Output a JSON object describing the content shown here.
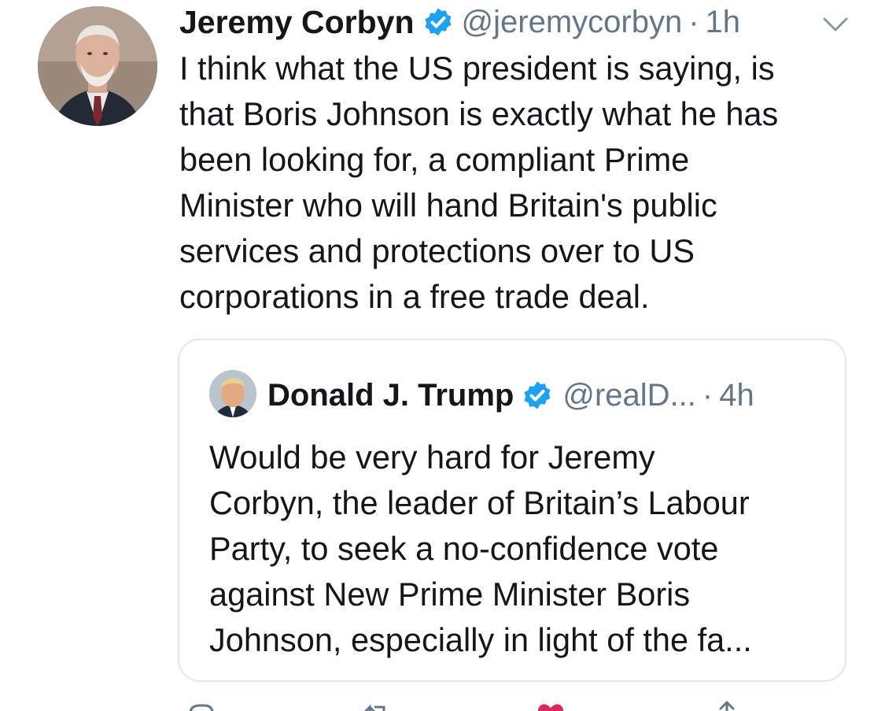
{
  "tweet": {
    "author_name": "Jeremy Corbyn",
    "handle": "@jeremycorbyn",
    "separator": "·",
    "time": "1h",
    "text": "I think what the US president is saying, is\nthat Boris Johnson is exactly what he has\nbeen looking for, a compliant Prime\nMinister who will hand Britain's public\nservices and protections over to US\ncorporations in a free trade deal.",
    "icons": {
      "verified": "verified-badge-icon",
      "menu": "chevron-down-icon"
    }
  },
  "quoted_tweet": {
    "author_name": "Donald J. Trump",
    "handle": "@realD...",
    "separator": "·",
    "time": "4h",
    "text": "Would be very hard for Jeremy\nCorbyn, the leader of Britain’s Labour\nParty, to seek a no-confidence vote\nagainst New Prime Minister Boris\nJohnson, especially in light of the fa..."
  },
  "actions": {
    "icons": [
      "reply-icon",
      "retweet-icon",
      "like-icon",
      "share-icon"
    ]
  },
  "colors": {
    "verified_blue": "#1da1f2",
    "secondary_text": "#657786",
    "primary_text": "#14171a",
    "border": "#e1e8ed",
    "like_red": "#e0245e"
  }
}
